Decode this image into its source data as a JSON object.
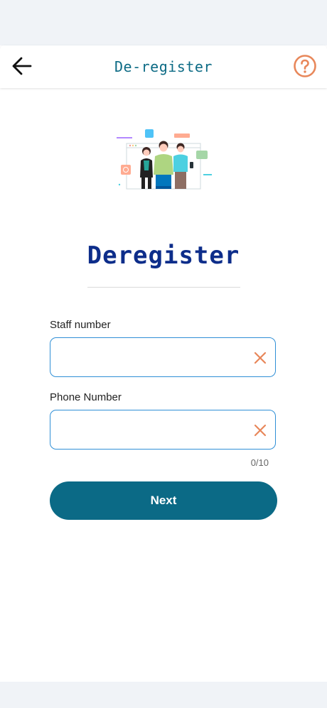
{
  "header": {
    "title": "De-register",
    "back_icon": "arrow-left-icon",
    "help_icon": "help-circle-icon"
  },
  "colors": {
    "primary": "#0b6a86",
    "heading": "#0d2d8a",
    "accent": "#e8875a",
    "field_border": "#2f8fd6"
  },
  "main": {
    "heading": "Deregister",
    "illustration": "team-people-illustration"
  },
  "form": {
    "staff_number": {
      "label": "Staff number",
      "value": "",
      "clear_icon": "close-icon"
    },
    "phone_number": {
      "label": "Phone Number",
      "value": "",
      "counter": "0/10",
      "clear_icon": "close-icon"
    },
    "next_label": "Next"
  }
}
